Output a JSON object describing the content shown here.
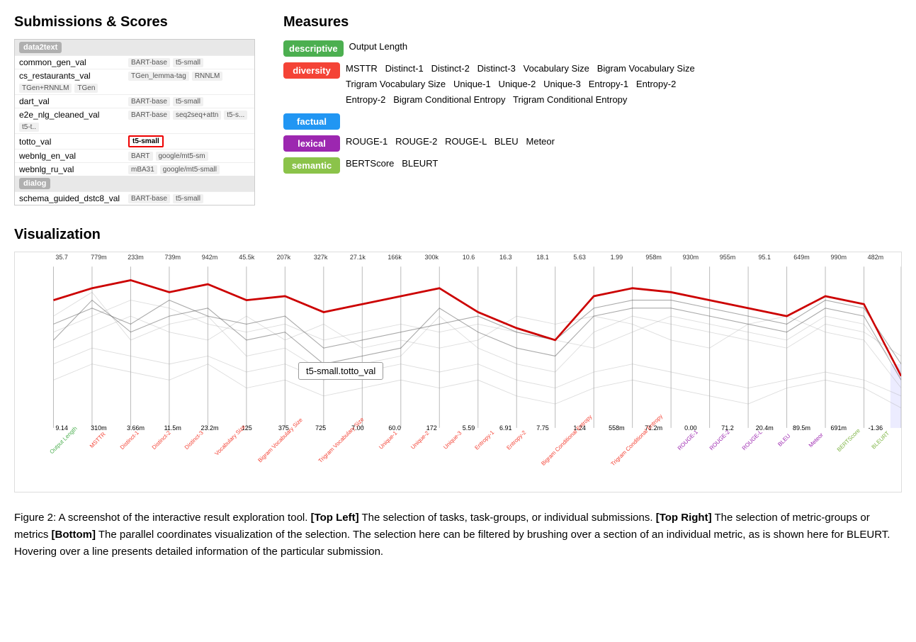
{
  "submissions": {
    "title": "Submissions & Scores",
    "groups": [
      {
        "label": "data2text",
        "datasets": [
          {
            "name": "common_gen_val",
            "tags": [
              "BART-base",
              "t5-small"
            ]
          },
          {
            "name": "cs_restaurants_val",
            "tags": [
              "TGen_lemma-tag",
              "RNNLM",
              "TGen+RNNLM",
              "TGen"
            ]
          },
          {
            "name": "dart_val",
            "tags": [
              "BART-base",
              "t5-small"
            ]
          },
          {
            "name": "e2e_nlg_cleaned_val",
            "tags": [
              "BART-base",
              "seq2seq+attn",
              "t5-s...",
              "t5-t.."
            ]
          },
          {
            "name": "totto_val",
            "tags": [
              "t5-small"
            ],
            "selected_tag": "t5-small"
          },
          {
            "name": "webnlg_en_val",
            "tags": [
              "BART",
              "google/mt5-sm"
            ]
          },
          {
            "name": "webnlg_ru_val",
            "tags": [
              "mBA31",
              "google/mt5-small"
            ]
          }
        ]
      },
      {
        "label": "dialog",
        "datasets": [
          {
            "name": "schema_guided_dstc8_val",
            "tags": [
              "BART-base",
              "t5-small"
            ]
          }
        ]
      }
    ]
  },
  "measures": {
    "title": "Measures",
    "groups": [
      {
        "id": "descriptive",
        "label": "descriptive",
        "badge_class": "badge-descriptive",
        "metrics": "Output Length"
      },
      {
        "id": "diversity",
        "label": "diversity",
        "badge_class": "badge-diversity",
        "metrics": "MSTTR   Distinct-1   Distinct-2   Distinct-3   Vocabulary Size   Bigram Vocabulary Size\nTrigram Vocabulary Size   Unique-1   Unique-2   Unique-3   Entropy-1   Entropy-2\nEntropy-2   Bigram Conditional Entropy   Trigram Conditional Entropy"
      },
      {
        "id": "factual",
        "label": "factual",
        "badge_class": "badge-factual",
        "metrics": ""
      },
      {
        "id": "lexical",
        "label": "lexical",
        "badge_class": "badge-lexical",
        "metrics": "ROUGE-1   ROUGE-2   ROUGE-L   BLEU   Meteor"
      },
      {
        "id": "semantic",
        "label": "semantic",
        "badge_class": "badge-semantic",
        "metrics": "BERTScore   BLEURT"
      }
    ]
  },
  "visualization": {
    "title": "Visualization",
    "tooltip": "t5-small.totto_val",
    "top_labels": [
      "35.7",
      "779m",
      "233m",
      "739m",
      "942m",
      "45.5k",
      "207k",
      "327k",
      "27.1k",
      "166k",
      "300k",
      "10.6",
      "16.3",
      "18.1",
      "5.63",
      "1.99",
      "958m",
      "930m",
      "955m",
      "95.1",
      "649m",
      "990m",
      "482m"
    ],
    "bottom_labels": [
      {
        "text": "Output Length",
        "color": "green"
      },
      {
        "text": "MSTTR",
        "color": "red"
      },
      {
        "text": "Distinct-1",
        "color": "red"
      },
      {
        "text": "Distinct-2",
        "color": "red"
      },
      {
        "text": "Distinct-3",
        "color": "red"
      },
      {
        "text": "Vocabulary Size",
        "color": "red"
      },
      {
        "text": "Bigram Vocabulary Size",
        "color": "red"
      },
      {
        "text": "Trigram Vocabulary Size",
        "color": "red"
      },
      {
        "text": "Unique-1",
        "color": "red"
      },
      {
        "text": "Unique-2",
        "color": "red"
      },
      {
        "text": "Unique-3",
        "color": "red"
      },
      {
        "text": "Entropy-1",
        "color": "red"
      },
      {
        "text": "Entropy-2",
        "color": "red"
      },
      {
        "text": "Bigram Conditional Entropy",
        "color": "red"
      },
      {
        "text": "Trigram Conditional Entropy",
        "color": "red"
      },
      {
        "text": "ROUGE-1",
        "color": "purple"
      },
      {
        "text": "ROUGE-2",
        "color": "purple"
      },
      {
        "text": "ROUGE-L",
        "color": "purple"
      },
      {
        "text": "BLEU",
        "color": "purple"
      },
      {
        "text": "Meteor",
        "color": "purple"
      },
      {
        "text": "BERTScore",
        "color": "olive"
      },
      {
        "text": "BLEURT",
        "color": "olive"
      }
    ],
    "bottom_numbers": [
      "9.14",
      "310m",
      "3.66m",
      "11.5m",
      "23.2m",
      "125",
      "375",
      "725",
      "7.00",
      "60.0",
      "172",
      "5.59",
      "6.91",
      "7.75",
      "1.24",
      "558m",
      "71.2m",
      "0.00",
      "71.2",
      "20.4m",
      "89.5m",
      "691m",
      "-1.36"
    ]
  },
  "caption": {
    "figure_num": "Figure 2:",
    "text": " A screenshot of the interactive result exploration tool. ",
    "top_left_label": "[Top Left]",
    "top_left_text": " The selection of tasks, task-groups, or individual submissions. ",
    "top_right_label": "[Top Right]",
    "top_right_text": " The selection of metric-groups or metrics ",
    "bottom_label": "[Bottom]",
    "bottom_text": " The parallel coordinates visualization of the selection. The selection here can be filtered by brushing over a section of an individual metric, as is shown here for BLEURT. Hovering over a line presents detailed information of the particular submission."
  }
}
